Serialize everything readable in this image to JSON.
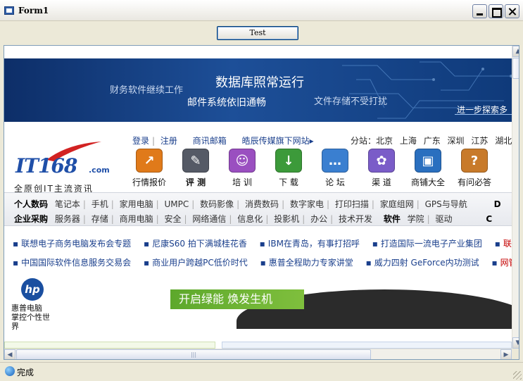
{
  "window": {
    "title": "Form1"
  },
  "toolbar": {
    "test_label": "Test"
  },
  "banner": {
    "line1": "财务软件继续工作",
    "line2": "数据库照常运行",
    "line3": "邮件系统依旧通畅",
    "line4": "文件存储不受打扰",
    "link": "进一步探索多"
  },
  "logo": {
    "main": "IT168",
    "com": ".com",
    "slogan": "全原创IT主流资讯"
  },
  "toplinks": [
    "登录",
    "注册",
    "商讯邮箱",
    "皓辰传媒旗下网站▸"
  ],
  "cities": [
    "分站：北京",
    "上海",
    "广东",
    "深圳",
    "江苏",
    "湖北",
    "湖"
  ],
  "icons": [
    {
      "label": "行情报价",
      "color": "#e07a1a",
      "glyph": "↗"
    },
    {
      "label": "评 测",
      "color": "#555a66",
      "glyph": "✎"
    },
    {
      "label": "培 训",
      "color": "#9a4fc0",
      "glyph": "☺"
    },
    {
      "label": "下 载",
      "color": "#3c9a3a",
      "glyph": "↓"
    },
    {
      "label": "论 坛",
      "color": "#3a7fd0",
      "glyph": "…"
    },
    {
      "label": "渠 道",
      "color": "#7a5cc8",
      "glyph": "✿"
    },
    {
      "label": "商铺大全",
      "color": "#2a6fbf",
      "glyph": "▣"
    },
    {
      "label": "有问必答",
      "color": "#c87a2a",
      "glyph": "?"
    }
  ],
  "categories": {
    "row1_head": "个人数码",
    "row1": [
      "笔记本",
      "手机",
      "家用电脑",
      "UMPC",
      "数码影像",
      "消费数码",
      "数字家电",
      "打印扫描",
      "家庭组网",
      "GPS与导航",
      "D"
    ],
    "row2_head": "企业采购",
    "row2": [
      "服务器",
      "存储",
      "商用电脑",
      "安全",
      "网络通信",
      "信息化",
      "投影机",
      "办公",
      "技术开发"
    ],
    "row2_extra_head": "软件",
    "row2_extra": [
      "学院",
      "驱动",
      "C"
    ]
  },
  "news": {
    "row1": [
      "联想电子商务电脑发布会专题",
      "尼康S60 拍下满城桂花香",
      "IBM在青岛，有事打招呼",
      "打造国际一流电子产业集团",
      "联想指纹"
    ],
    "row2": [
      "中国国际软件信息服务交易会",
      "商业用户跨越PC低价时代",
      "惠普全程助力专家讲堂",
      "威力四射 GeForce内功测试",
      "网管软件("
    ]
  },
  "ad": {
    "hp_logo": "hp",
    "hp_text1": "惠普电脑",
    "hp_text2": "掌控个性世界",
    "green_text": "开启绿能 焕发生机"
  },
  "status": {
    "text": "完成"
  }
}
